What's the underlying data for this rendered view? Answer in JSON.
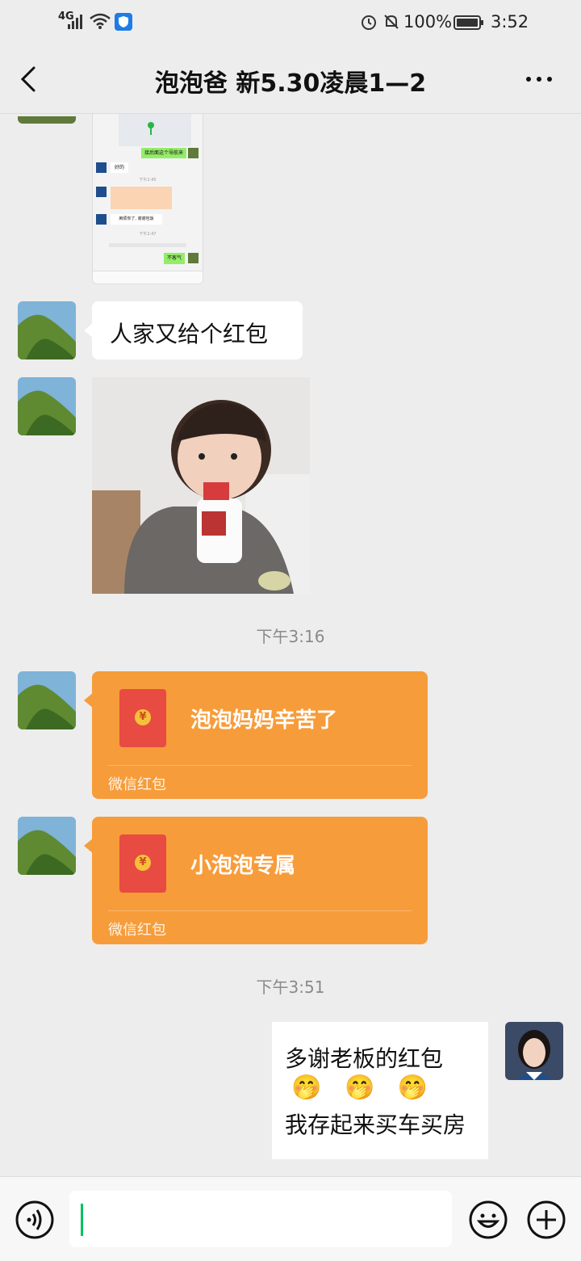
{
  "status_bar": {
    "network": "4G",
    "battery": "100%",
    "time": "3:52"
  },
  "nav": {
    "title": "泡泡爸 新5.30凌晨1—2"
  },
  "screenshot_thumb": {
    "lines": [
      "接后面这个导航来",
      "好的",
      "下午2:45",
      "麻烦你了, 谢谢包饭",
      "下午2:47",
      "不客气"
    ]
  },
  "messages": {
    "text1": "人家又给个红包",
    "time1": "下午3:16",
    "red_packet_1": {
      "title": "泡泡妈妈辛苦了",
      "footer": "微信红包",
      "coin": "¥"
    },
    "red_packet_2": {
      "title": "小泡泡专属",
      "footer": "微信红包",
      "coin": "¥"
    },
    "time2": "下午3:51",
    "reply": {
      "line1": "多谢老板的红包",
      "emojis": "🤭   🤭   🤭",
      "line2": "我存起来买车买房"
    }
  },
  "colors": {
    "background": "#ededed",
    "red_packet": "#f79c3a",
    "envelope": "#e84b42",
    "accent_green": "#07c160"
  }
}
